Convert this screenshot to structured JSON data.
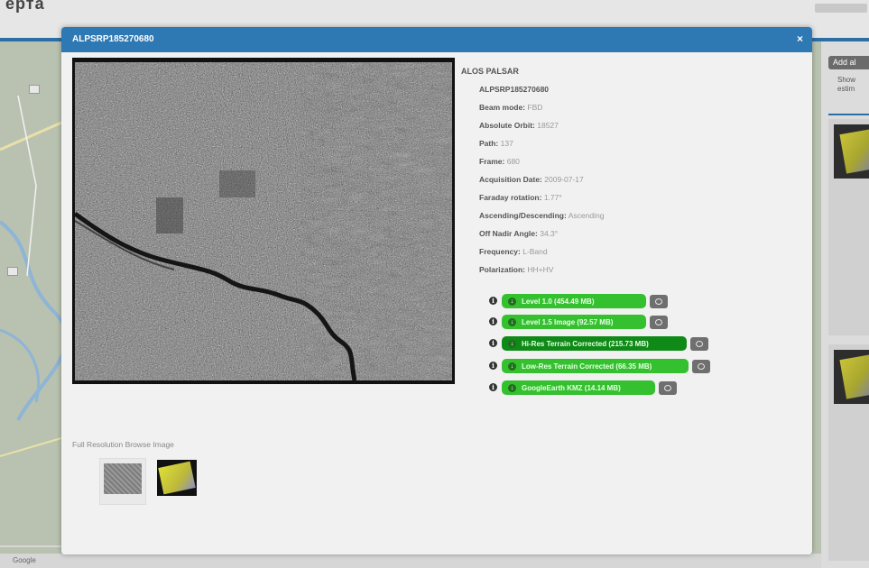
{
  "background": {
    "logo_text": "ерта",
    "add_button_label": "Add al",
    "side_text_1": "Show",
    "side_text_2": "estim",
    "map_footer_text": "Google"
  },
  "modal": {
    "title": "ALPSRP185270680",
    "close_icon": "×",
    "platform": "ALOS PALSAR",
    "granule_name": "ALPSRP185270680",
    "metadata": [
      {
        "label": "Beam mode:",
        "value": "FBD"
      },
      {
        "label": "Absolute Orbit:",
        "value": "18527"
      },
      {
        "label": "Path:",
        "value": "137"
      },
      {
        "label": "Frame:",
        "value": "680"
      },
      {
        "label": "Acquisition Date:",
        "value": "2009-07-17"
      },
      {
        "label": "Faraday rotation:",
        "value": "1.77°"
      },
      {
        "label": "Ascending/Descending:",
        "value": "Ascending"
      },
      {
        "label": "Off Nadir Angle:",
        "value": "34.3°"
      },
      {
        "label": "Frequency:",
        "value": "L-Band"
      },
      {
        "label": "Polarization:",
        "value": "HH+HV"
      }
    ],
    "downloads": [
      {
        "label": "Level 1.0 (454.49 MB)",
        "style": "green"
      },
      {
        "label": "Level 1.5 Image (92.57 MB)",
        "style": "green"
      },
      {
        "label": "Hi-Res Terrain Corrected (215.73 MB)",
        "style": "dark-green"
      },
      {
        "label": "Low-Res Terrain Corrected (66.35 MB)",
        "style": "green"
      },
      {
        "label": "GoogleEarth KMZ (14.14 MB)",
        "style": "green"
      }
    ],
    "full_res_label": "Full Resolution Browse Image",
    "colors": {
      "header": "#2e78b3",
      "download_green": "#35c12f",
      "download_dark_green": "#0f8a17",
      "queue_gray": "#6f6f6f"
    }
  }
}
